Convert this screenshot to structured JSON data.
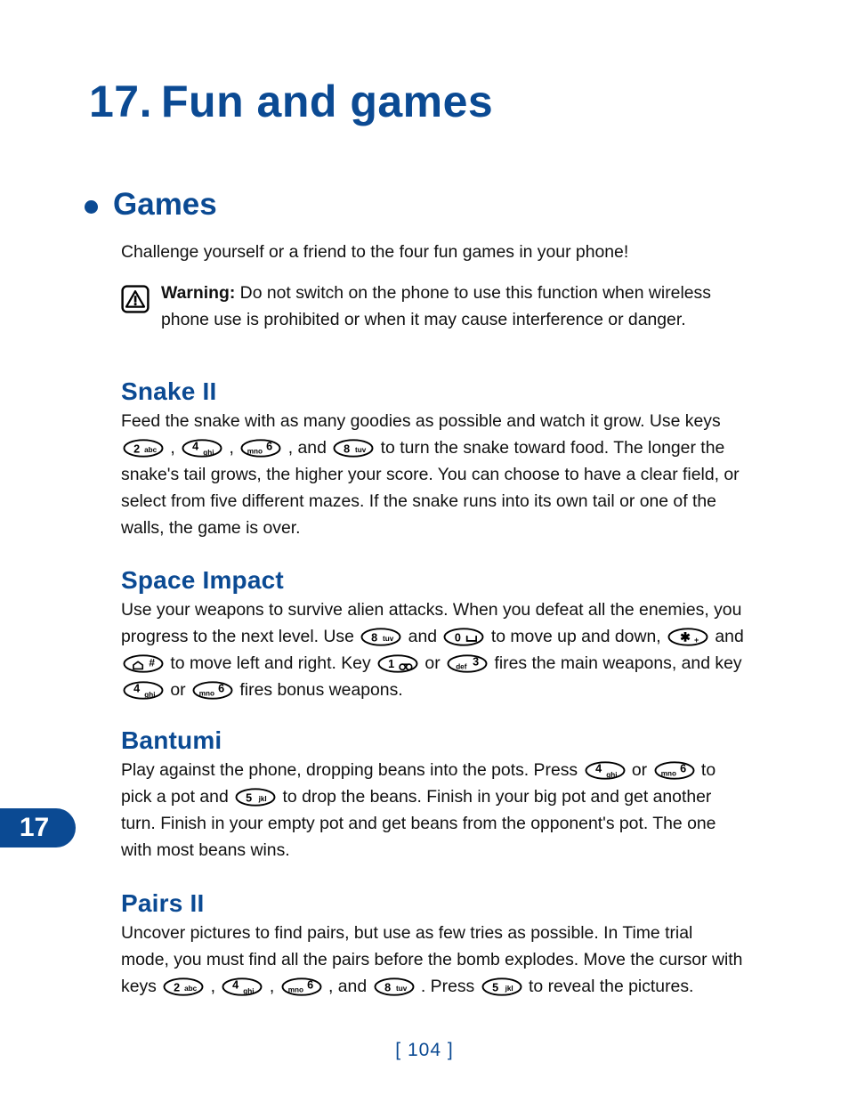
{
  "document": {
    "chapter_number": "17.",
    "chapter_title": "Fun and games",
    "chapter_tab_label": "17",
    "page_footer": "[ 104 ]",
    "accent_color": "#0B4A93",
    "text_color": "#111111"
  },
  "section": {
    "bullet_icon": "bullet-dot-icon",
    "heading": "Games",
    "intro": "Challenge yourself or a friend to the four fun games in your phone!"
  },
  "warning": {
    "icon": "warning-triangle-icon",
    "label": "Warning:",
    "text": " Do not switch on the phone to use this function when wireless phone use is prohibited or when it may cause interference or danger."
  },
  "games": [
    {
      "title": "Snake II",
      "paragraph_parts": [
        {
          "type": "text",
          "value": "Feed the snake with as many goodies as possible and watch it grow. Use keys "
        },
        {
          "type": "key",
          "key": "2abc"
        },
        {
          "type": "text",
          "value": " , "
        },
        {
          "type": "key",
          "key": "4ghi"
        },
        {
          "type": "text",
          "value": " , "
        },
        {
          "type": "key",
          "key": "6mno"
        },
        {
          "type": "text",
          "value": " , and "
        },
        {
          "type": "key",
          "key": "8tuv"
        },
        {
          "type": "text",
          "value": " to turn the snake toward food. The longer the snake's tail grows, the higher your score. You can choose to have a clear field, or select from five different mazes. If the snake runs into its own tail or one of the walls, the game is over."
        }
      ]
    },
    {
      "title": "Space Impact",
      "paragraph_parts": [
        {
          "type": "text",
          "value": "Use your weapons to survive alien attacks. When you defeat all the enemies, you progress to the next level. Use "
        },
        {
          "type": "key",
          "key": "8tuv"
        },
        {
          "type": "text",
          "value": " and "
        },
        {
          "type": "key",
          "key": "0space"
        },
        {
          "type": "text",
          "value": " to move up and down, "
        },
        {
          "type": "key",
          "key": "star"
        },
        {
          "type": "text",
          "value": " and "
        },
        {
          "type": "key",
          "key": "hash"
        },
        {
          "type": "text",
          "value": " to move left and right. Key "
        },
        {
          "type": "key",
          "key": "1voicemail"
        },
        {
          "type": "text",
          "value": " or "
        },
        {
          "type": "key",
          "key": "3def"
        },
        {
          "type": "text",
          "value": " fires the main weapons, and key "
        },
        {
          "type": "key",
          "key": "4ghi"
        },
        {
          "type": "text",
          "value": " or "
        },
        {
          "type": "key",
          "key": "6mno"
        },
        {
          "type": "text",
          "value": " fires bonus weapons."
        }
      ]
    },
    {
      "title": "Bantumi",
      "paragraph_parts": [
        {
          "type": "text",
          "value": "Play against the phone, dropping beans into the pots. Press "
        },
        {
          "type": "key",
          "key": "4ghi"
        },
        {
          "type": "text",
          "value": " or "
        },
        {
          "type": "key",
          "key": "6mno"
        },
        {
          "type": "text",
          "value": " to pick a pot and "
        },
        {
          "type": "key",
          "key": "5jkl"
        },
        {
          "type": "text",
          "value": " to drop the beans. Finish in your big pot and get another turn. Finish in your empty pot and get beans from the opponent's pot. The one with most beans wins."
        }
      ]
    },
    {
      "title": "Pairs II",
      "paragraph_parts": [
        {
          "type": "text",
          "value": "Uncover pictures to find pairs, but use as few tries as possible. In Time trial mode, you must find all the pairs before the bomb explodes. Move the cursor with keys "
        },
        {
          "type": "key",
          "key": "2abc"
        },
        {
          "type": "text",
          "value": " , "
        },
        {
          "type": "key",
          "key": "4ghi"
        },
        {
          "type": "text",
          "value": " , "
        },
        {
          "type": "key",
          "key": "6mno"
        },
        {
          "type": "text",
          "value": " , and "
        },
        {
          "type": "key",
          "key": "8tuv"
        },
        {
          "type": "text",
          "value": " . Press "
        },
        {
          "type": "key",
          "key": "5jkl"
        },
        {
          "type": "text",
          "value": " to reveal the pictures."
        }
      ]
    }
  ],
  "keys": {
    "2abc": {
      "name": "key-2-abc",
      "digit": "2",
      "letters": "abc",
      "layout": "digit-left"
    },
    "4ghi": {
      "name": "key-4-ghi",
      "digit": "4",
      "letters": "ghi",
      "layout": "digit-upper-left"
    },
    "5jkl": {
      "name": "key-5-jkl",
      "digit": "5",
      "letters": "jkl",
      "layout": "digit-left"
    },
    "6mno": {
      "name": "key-6-mno",
      "digit": "6",
      "letters": "mno",
      "layout": "digit-upper-right"
    },
    "8tuv": {
      "name": "key-8-tuv",
      "digit": "8",
      "letters": "tuv",
      "layout": "digit-left"
    },
    "3def": {
      "name": "key-3-def",
      "digit": "3",
      "letters": "def",
      "layout": "digit-upper-right"
    },
    "1voicemail": {
      "name": "key-1-voicemail",
      "digit": "1",
      "letters": "",
      "layout": "voicemail"
    },
    "0space": {
      "name": "key-0-space",
      "digit": "0",
      "letters": "",
      "layout": "spacebar"
    },
    "star": {
      "name": "key-star-plus",
      "digit": "*",
      "letters": "+",
      "layout": "star"
    },
    "hash": {
      "name": "key-hash-home",
      "digit": "#",
      "letters": "",
      "layout": "hash"
    }
  },
  "layout": {
    "game_tops": [
      425,
      637,
      817,
      1000
    ]
  }
}
